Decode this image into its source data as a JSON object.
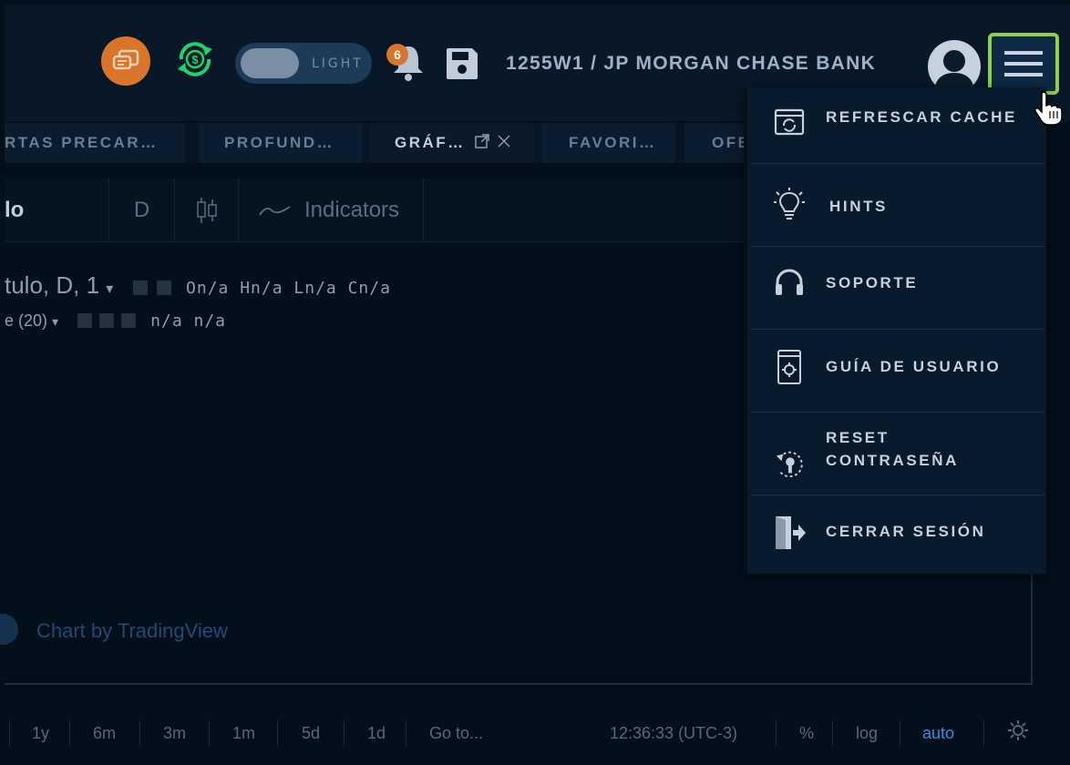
{
  "header": {
    "theme_toggle_label": "LIGHT",
    "notification_count": "6",
    "bank_title": "1255W1 / JP MORGAN CHASE BANK"
  },
  "tabs": [
    {
      "label": "RTAS PRECAR…"
    },
    {
      "label": "PROFUND…"
    },
    {
      "label": "GRÁF…"
    },
    {
      "label": "FAVORI…"
    },
    {
      "label": "OFE"
    }
  ],
  "chart": {
    "toolbar": {
      "symbol_partial": "lo",
      "interval": "D",
      "indicators_label": "Indicators"
    },
    "legend": {
      "main": "tulo, D, 1",
      "ohlc": "On/a Hn/a Ln/a Cn/a",
      "study": "e (20)",
      "study_values": "n/a n/a"
    },
    "watermark": "Chart by TradingView"
  },
  "bottom_bar": {
    "ranges": [
      "1y",
      "6m",
      "3m",
      "1m",
      "5d",
      "1d"
    ],
    "goto": "Go to...",
    "time": "12:36:33 (UTC-3)",
    "percent": "%",
    "log": "log",
    "auto": "auto"
  },
  "menu": {
    "items": [
      {
        "label": "REFRESCAR CACHE",
        "icon": "refresh-cache-icon"
      },
      {
        "label": "HINTS",
        "icon": "lightbulb-icon"
      },
      {
        "label": "SOPORTE",
        "icon": "headset-icon"
      },
      {
        "label": "GUÍA DE USUARIO",
        "icon": "user-guide-icon"
      },
      {
        "label": "RESET",
        "label2": "CONTRASEÑA",
        "icon": "key-reset-icon"
      },
      {
        "label": "CERRAR SESIÓN",
        "icon": "logout-icon"
      }
    ]
  },
  "colors": {
    "accent_orange": "#d9742b",
    "accent_green": "#1fd36b",
    "menu_highlight": "#8fd14f",
    "background": "#040f1c"
  }
}
